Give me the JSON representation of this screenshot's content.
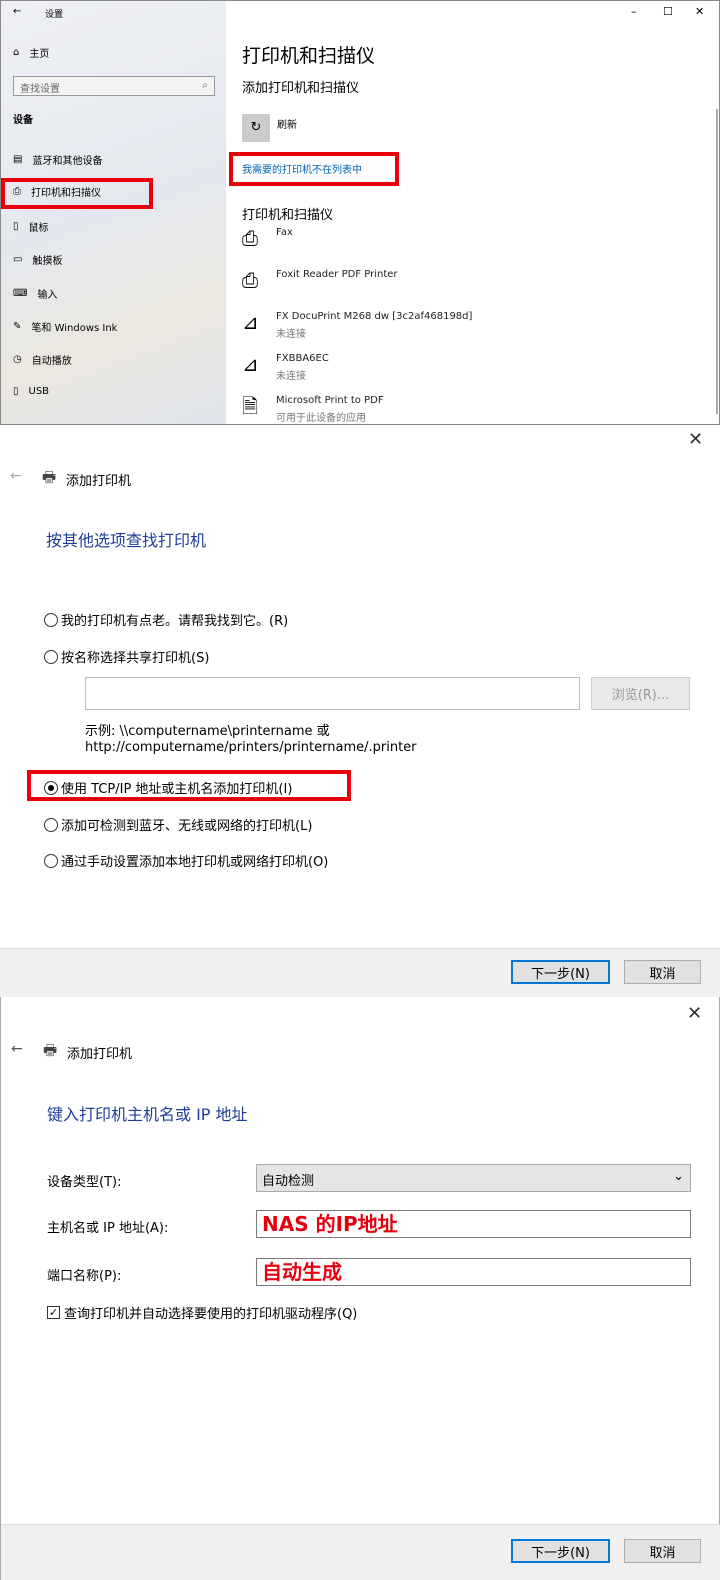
{
  "settings": {
    "window_title": "设置",
    "home": "主页",
    "search_placeholder": "查找设置",
    "section": "设备",
    "nav": [
      "蓝牙和其他设备",
      "打印机和扫描仪",
      "鼠标",
      "触摸板",
      "输入",
      "笔和 Windows Ink",
      "自动播放",
      "USB"
    ],
    "nav_icons": [
      "bluetooth-devices-icon",
      "printer-icon",
      "mouse-icon",
      "touchpad-icon",
      "keyboard-icon",
      "pen-icon",
      "autoplay-icon",
      "usb-icon"
    ],
    "page_title": "打印机和扫描仪",
    "add_heading": "添加打印机和扫描仪",
    "refresh": "刷新",
    "not_listed_link": "我需要的打印机不在列表中",
    "list_heading": "打印机和扫描仪",
    "printers": [
      {
        "name": "Fax",
        "status": "",
        "icon": "printer-icon"
      },
      {
        "name": "Foxit Reader PDF Printer",
        "status": "",
        "icon": "printer-icon"
      },
      {
        "name": "FX DocuPrint M268 dw [3c2af468198d]",
        "status": "未连接",
        "icon": "scanner-icon"
      },
      {
        "name": "FXBBA6EC",
        "status": "未连接",
        "icon": "scanner-icon"
      },
      {
        "name": "Microsoft Print to PDF",
        "status": "可用于此设备的应用",
        "icon": "pdf-printer-icon"
      }
    ]
  },
  "dialog1": {
    "title": "添加打印机",
    "heading": "按其他选项查找打印机",
    "options": [
      "我的打印机有点老。请帮我找到它。(R)",
      "按名称选择共享打印机(S)",
      "使用 TCP/IP 地址或主机名添加打印机(I)",
      "添加可检测到蓝牙、无线或网络的打印机(L)",
      "通过手动设置添加本地打印机或网络打印机(O)"
    ],
    "selected": 2,
    "share_input": "",
    "browse": "浏览(R)...",
    "example_line1": "示例: \\\\computername\\printername 或",
    "example_line2": "http://computername/printers/printername/.printer",
    "next": "下一步(N)",
    "cancel": "取消"
  },
  "dialog2": {
    "title": "添加打印机",
    "heading": "键入打印机主机名或 IP 地址",
    "device_type_label": "设备类型(T):",
    "device_type_value": "自动检测",
    "host_label": "主机名或 IP 地址(A):",
    "host_value": "NAS 的IP地址",
    "port_label": "端口名称(P):",
    "port_value": "自动生成",
    "query_checkbox": "查询打印机并自动选择要使用的打印机驱动程序(Q)",
    "query_checked": true,
    "next": "下一步(N)",
    "cancel": "取消"
  },
  "colors": {
    "highlight": "#e8000b",
    "link": "#0063b1",
    "heading_blue": "#1e3e9a",
    "primary_border": "#0078d7"
  }
}
